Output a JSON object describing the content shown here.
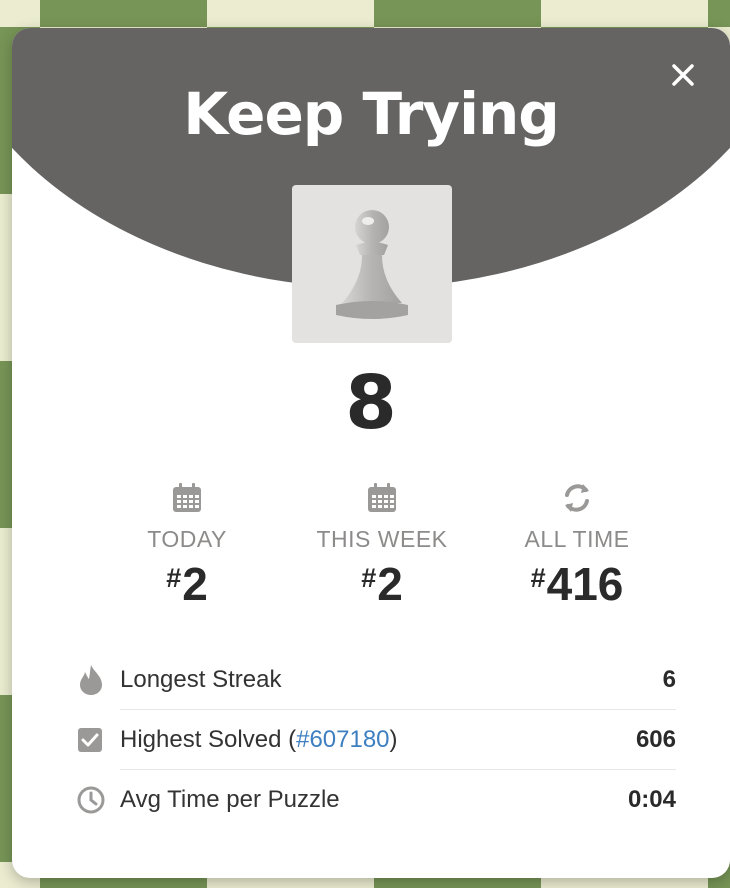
{
  "modal": {
    "title": "Keep Trying",
    "close_icon": "close-icon",
    "piece_icon": "pawn-icon",
    "score": "8"
  },
  "ranks": [
    {
      "icon": "calendar-icon",
      "label": "TODAY",
      "hash": "#",
      "value": "2"
    },
    {
      "icon": "calendar-icon",
      "label": "THIS WEEK",
      "hash": "#",
      "value": "2"
    },
    {
      "icon": "refresh-icon",
      "label": "ALL TIME",
      "hash": "#",
      "value": "416"
    }
  ],
  "stats": {
    "longest_streak": {
      "icon": "flame-icon",
      "label": "Longest Streak",
      "value": "6"
    },
    "highest_solved": {
      "icon": "checkbox-icon",
      "label_prefix": "Highest Solved (",
      "link": "#607180",
      "label_suffix": ")",
      "value": "606"
    },
    "avg_time": {
      "icon": "clock-icon",
      "label": "Avg Time per Puzzle",
      "value": "0:04"
    }
  },
  "colors": {
    "header": "#656463",
    "board_dark": "#779556",
    "board_light": "#ebecd0",
    "link": "#3d7fc1",
    "muted": "#8c8b8a"
  }
}
